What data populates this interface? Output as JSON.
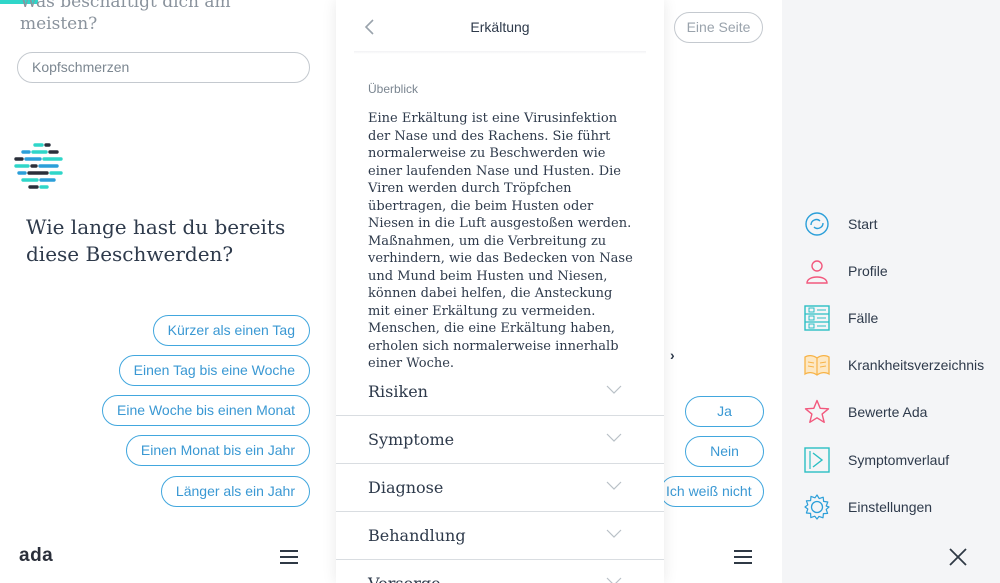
{
  "left_panel": {
    "previous_question": "Was beschäftigt dich am meisten?",
    "answer_value": "Kopfschmerzen",
    "question": "Wie lange hast du bereits diese Beschwerden?",
    "options": [
      "Kürzer als einen Tag",
      "Einen Tag bis eine Woche",
      "Eine Woche bis einen Monat",
      "Einen Monat bis ein Jahr",
      "Länger als ein Jahr"
    ],
    "logo": "ada",
    "accent_color": "#2fd6c9"
  },
  "middle_panel": {
    "one_page_button": "Eine Seite",
    "partial_text": "›",
    "options": [
      "Ja",
      "Nein",
      "Ich weiß nicht"
    ]
  },
  "article": {
    "title": "Erkältung",
    "overview_label": "Überblick",
    "overview_text": "Eine Erkältung ist eine Virusinfektion der Nase und des Rachens. Sie führt normalerweise zu Beschwerden wie einer laufenden Nase und Husten. Die Viren werden durch Tröpfchen übertragen, die beim Husten oder Niesen in die Luft ausgestoßen werden. Maßnahmen, um die Verbreitung zu verhindern, wie das Bedecken von Nase und Mund beim Husten und Niesen, können dabei helfen, die Ansteckung mit einer Erkältung zu vermeiden. Menschen, die eine Erkältung haben, erholen sich normalerweise innerhalb einer Woche.",
    "sections": [
      "Risiken",
      "Symptome",
      "Diagnose",
      "Behandlung",
      "Vorsorge"
    ]
  },
  "drawer": {
    "items": [
      {
        "label": "Start",
        "icon": "start-icon"
      },
      {
        "label": "Profile",
        "icon": "profile-icon"
      },
      {
        "label": "Fälle",
        "icon": "cases-icon"
      },
      {
        "label": "Krankheitsverzeichnis",
        "icon": "book-icon"
      },
      {
        "label": "Bewerte Ada",
        "icon": "star-icon"
      },
      {
        "label": "Symptomverlauf",
        "icon": "symptom-tracker-icon"
      },
      {
        "label": "Einstellungen",
        "icon": "gear-icon"
      }
    ],
    "close_icon": "close-icon",
    "colors": {
      "start": "#2b9fd9",
      "profile": "#f2587d",
      "cases": "#2bbfc4",
      "book": "#f7b347",
      "star": "#f2587d",
      "symptom": "#2bbfc4",
      "settings": "#2b9fd9"
    }
  },
  "brand_colors": {
    "button_blue": "#42a7de",
    "text_dark": "#2e3a4b",
    "drawer_bg": "#f4f5f7"
  }
}
